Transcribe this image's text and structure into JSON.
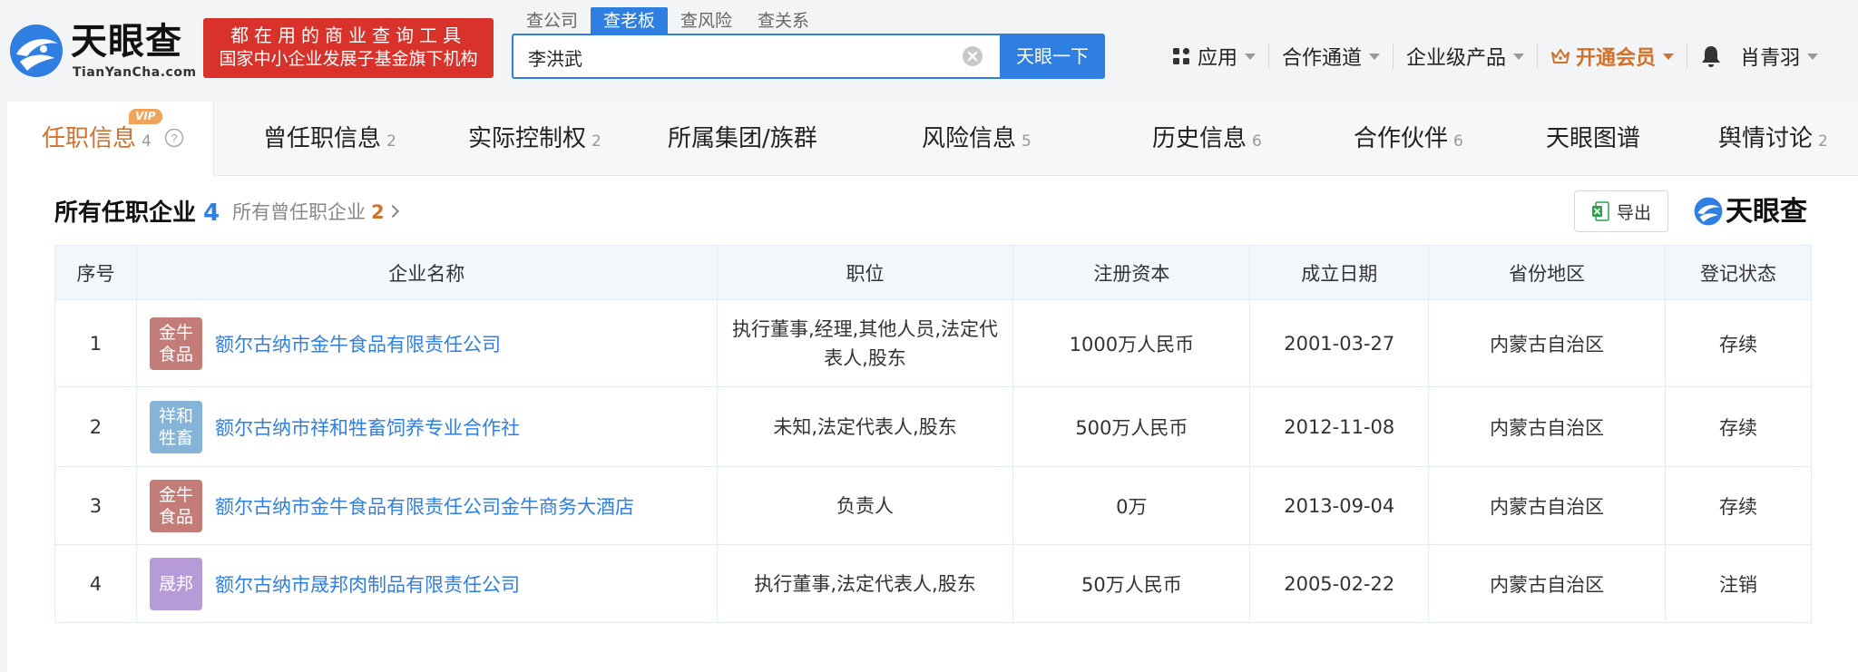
{
  "header": {
    "logo_cn": "天眼查",
    "logo_en": "TianYanCha.com",
    "slogan_line1": "都在用的商业查询工具",
    "slogan_line2": "国家中小企业发展子基金旗下机构",
    "search_tabs": [
      "查公司",
      "查老板",
      "查风险",
      "查关系"
    ],
    "search_value": "李洪武",
    "search_button": "天眼一下",
    "nav": {
      "apps": "应用",
      "partner": "合作通道",
      "enterprise": "企业级产品",
      "vip": "开通会员",
      "user": "肖青羽"
    }
  },
  "subtabs": {
    "vip_badge": "VIP",
    "items": [
      {
        "label": "任职信息",
        "count": "4"
      },
      {
        "label": "曾任职信息",
        "count": "2"
      },
      {
        "label": "实际控制权",
        "count": "2"
      },
      {
        "label": "所属集团/族群",
        "count": ""
      },
      {
        "label": "风险信息",
        "count": "5"
      },
      {
        "label": "历史信息",
        "count": "6"
      },
      {
        "label": "合作伙伴",
        "count": "6"
      },
      {
        "label": "天眼图谱",
        "count": ""
      },
      {
        "label": "舆情讨论",
        "count": "2"
      }
    ]
  },
  "section": {
    "title": "所有任职企业",
    "count": "4",
    "former_label": "所有曾任职企业",
    "former_count": "2",
    "export_label": "导出",
    "brand": "天眼查"
  },
  "table": {
    "headers": [
      "序号",
      "企业名称",
      "职位",
      "注册资本",
      "成立日期",
      "省份地区",
      "登记状态"
    ],
    "rows": [
      {
        "no": "1",
        "logo_text": "金牛\n食品",
        "logo_color": "#c47c79",
        "name": "额尔古纳市金牛食品有限责任公司",
        "position": "执行董事,经理,其他人员,法定代表人,股东",
        "capital": "1000万人民币",
        "date": "2001-03-27",
        "region": "内蒙古自治区",
        "status": "存续"
      },
      {
        "no": "2",
        "logo_text": "祥和\n牲畜",
        "logo_color": "#86b3d8",
        "name": "额尔古纳市祥和牲畜饲养专业合作社",
        "position": "未知,法定代表人,股东",
        "capital": "500万人民币",
        "date": "2012-11-08",
        "region": "内蒙古自治区",
        "status": "存续"
      },
      {
        "no": "3",
        "logo_text": "金牛\n食品",
        "logo_color": "#c47c79",
        "name": "额尔古纳市金牛食品有限责任公司金牛商务大酒店",
        "position": "负责人",
        "capital": "0万",
        "date": "2013-09-04",
        "region": "内蒙古自治区",
        "status": "存续"
      },
      {
        "no": "4",
        "logo_text": "晟邦",
        "logo_color": "#b79bd9",
        "name": "额尔古纳市晟邦肉制品有限责任公司",
        "position": "执行董事,法定代表人,股东",
        "capital": "50万人民币",
        "date": "2005-02-22",
        "region": "内蒙古自治区",
        "status": "注销"
      }
    ]
  },
  "colors": {
    "accent_blue": "#2f7fe3",
    "slogan_red": "#d9322b",
    "vip_orange": "#d3702a",
    "status_active": "#2aa34a",
    "status_cancelled": "#e0413a"
  }
}
